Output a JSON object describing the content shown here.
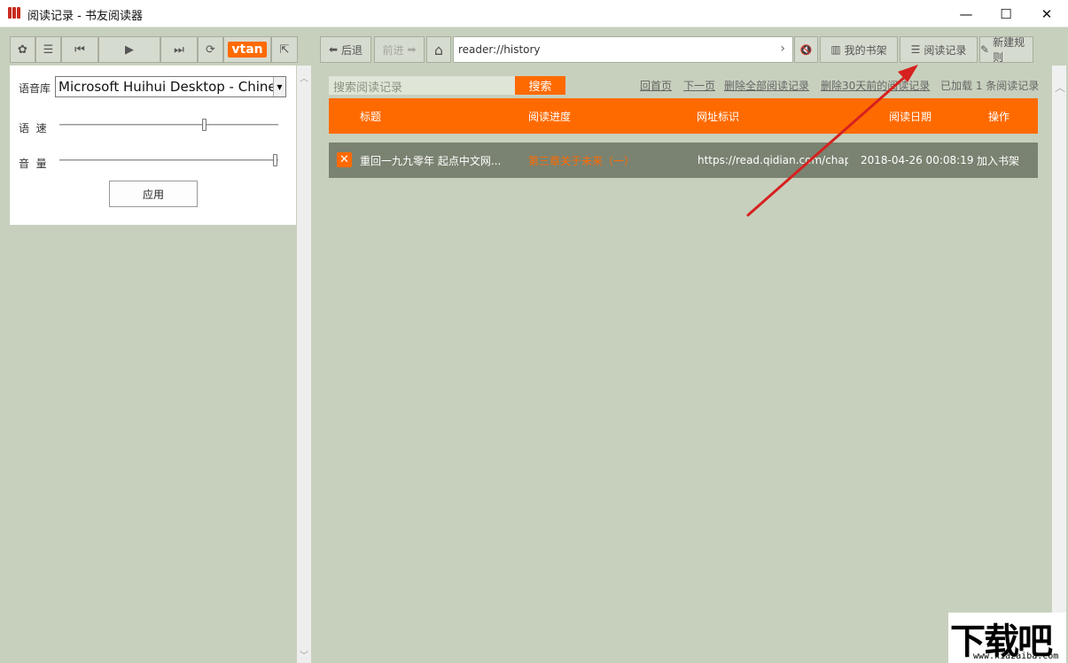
{
  "window": {
    "title": "阅读记录 - 书友阅读器",
    "minimize_icon": "—",
    "maximize_icon": "☐",
    "close_icon": "✕"
  },
  "left_toolbar": {
    "buttons": [
      {
        "name": "gear-icon",
        "glyph": "✿"
      },
      {
        "name": "menu-icon",
        "glyph": "☰"
      },
      {
        "name": "prev-icon",
        "glyph": "⏮"
      },
      {
        "name": "play-icon",
        "glyph": "▶"
      },
      {
        "name": "next-icon",
        "glyph": "⏭"
      },
      {
        "name": "refresh-icon",
        "glyph": "⟳"
      },
      {
        "name": "vtan-logo",
        "glyph": "vtan"
      },
      {
        "name": "export-icon",
        "glyph": "⇱"
      }
    ]
  },
  "tts_panel": {
    "voice_label": "语音库",
    "voice_value": "Microsoft Huihui Desktop - Chinese",
    "speed_label": "语  速",
    "volume_label": "音  量",
    "speed_level": 0.67,
    "volume_level": 1.0,
    "apply_label": "应用"
  },
  "nav_toolbar": {
    "back_label": "后退",
    "forward_label": "前进",
    "home_icon": "⌂",
    "url": "reader://history",
    "go_icon": "›",
    "mute_icon": "🔇",
    "bookshelf_label": "我的书架",
    "history_label": "阅读记录",
    "new_rule_label": "新建规则"
  },
  "history": {
    "search_placeholder": "搜索阅读记录",
    "search_button": "搜索",
    "links": {
      "first_page": "回首页",
      "next_page": "下一页",
      "delete_all": "删除全部阅读记录",
      "delete_30_days": "删除30天前的阅读记录"
    },
    "loaded_status": "已加载 1 条阅读记录",
    "columns": [
      "标题",
      "阅读进度",
      "网址标识",
      "阅读日期",
      "操作"
    ],
    "rows": [
      {
        "title": "重回一九九零年 起点中文网...",
        "progress": "第三章关于未来（一）",
        "url": "https://read.qidian.com/chapt...",
        "date": "2018-04-26 00:08:19",
        "action": "加入书架"
      }
    ]
  },
  "watermark": {
    "main": "下载吧",
    "sub": "www.xiazaiba.com"
  },
  "colors": {
    "accent": "#ff6a00",
    "background": "#c7d0bd",
    "row_bg": "#7a8371",
    "arrow": "#d6211f"
  }
}
